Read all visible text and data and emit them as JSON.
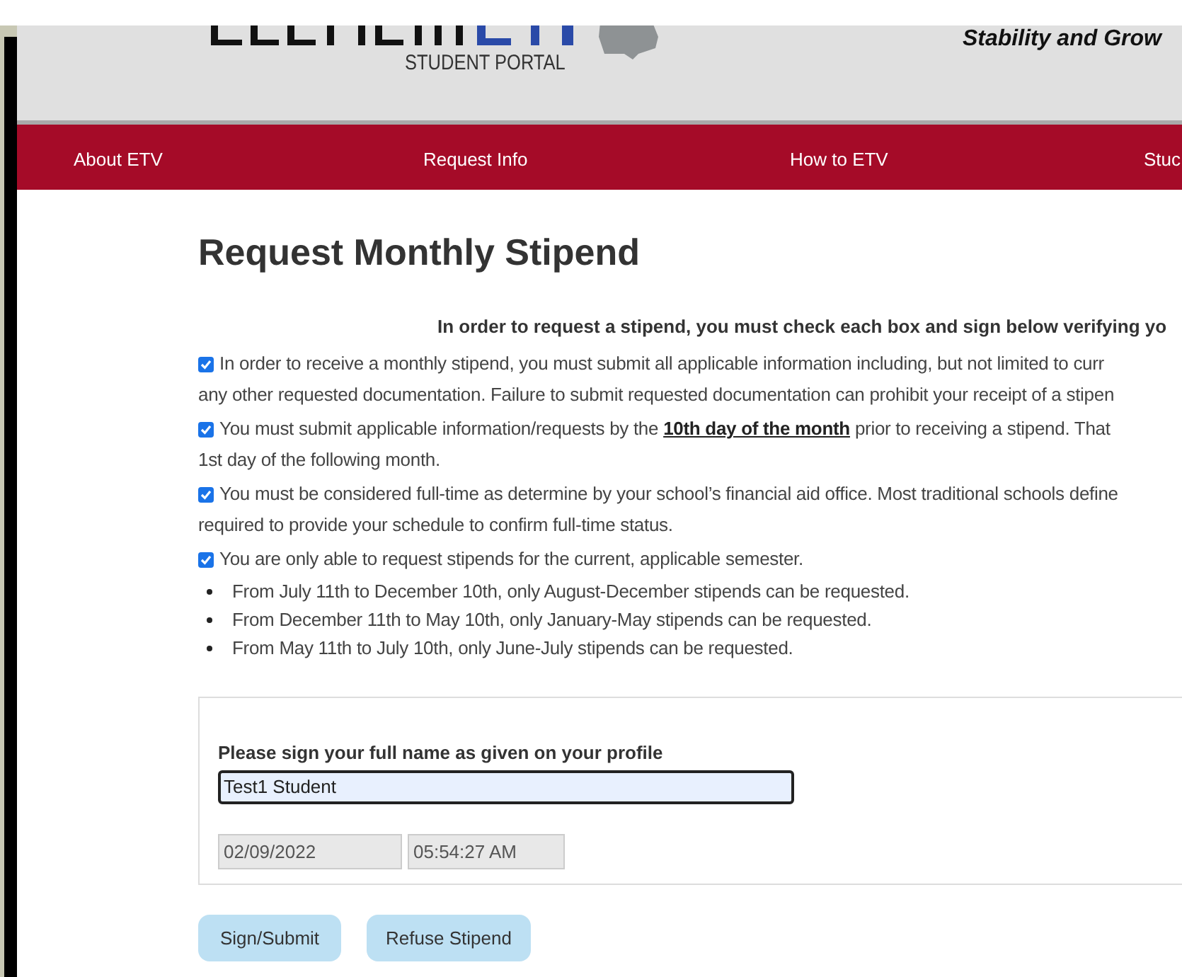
{
  "header": {
    "logo_sub": "STUDENT PORTAL",
    "tagline": "Stability and Grow"
  },
  "nav": [
    {
      "label": "About ETV"
    },
    {
      "label": "Request Info"
    },
    {
      "label": "How to ETV"
    },
    {
      "label": "Stuc"
    }
  ],
  "title": "Request Monthly Stipend",
  "intro": "In order to request a stipend, you must check each box and sign below verifying yo",
  "agreements": [
    {
      "checked": true,
      "lines": [
        "In order to receive a monthly stipend, you must submit all applicable information including, but not limited to curr",
        "any other requested documentation. Failure to submit requested documentation can prohibit your receipt of a stipen"
      ]
    },
    {
      "checked": true,
      "lines": [
        "You must submit applicable information/requests by the **10th day of the month** prior to receiving a stipend. That",
        "1st day of the following month."
      ]
    },
    {
      "checked": true,
      "lines": [
        "You must be considered full-time as determine by your school’s financial aid office. Most traditional schools define",
        "required to provide your schedule to confirm full-time status."
      ]
    },
    {
      "checked": true,
      "lines": [
        "You are only able to request stipends for the current, applicable semester."
      ]
    }
  ],
  "semester_rules": [
    "From July 11th to December 10th, only August-December stipends can be requested.",
    "From December 11th to May 10th, only January-May stipends can be requested.",
    "From May 11th to July 10th, only June-July stipends can be requested."
  ],
  "signature": {
    "label": "Please sign your full name as given on your profile",
    "value": "Test1 Student",
    "date": "02/09/2022",
    "time": "05:54:27 AM"
  },
  "buttons": [
    {
      "label": "Sign/Submit"
    },
    {
      "label": "Refuse Stipend"
    }
  ]
}
